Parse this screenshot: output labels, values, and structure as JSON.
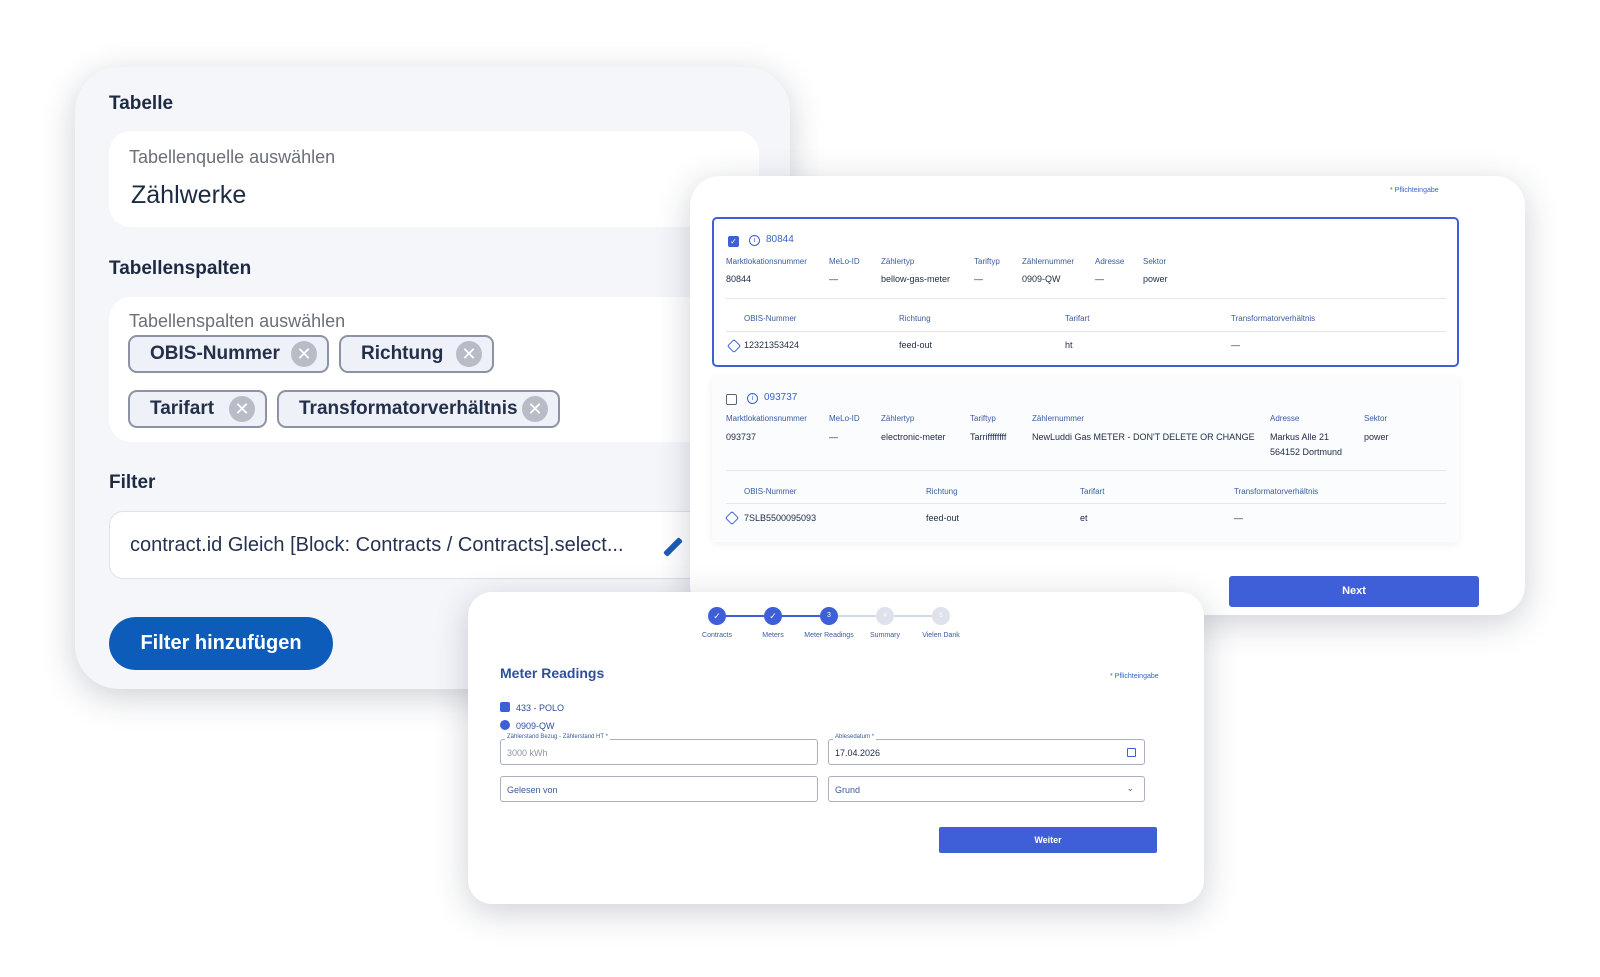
{
  "config": {
    "table_heading": "Tabelle",
    "source_label": "Tabellenquelle auswählen",
    "source_value": "Zählwerke",
    "columns_heading": "Tabellenspalten",
    "columns_label": "Tabellenspalten auswählen",
    "chips": [
      "OBIS-Nummer",
      "Richtung",
      "Tarifart",
      "Transformatorverhältnis"
    ],
    "filter_heading": "Filter",
    "filter_value": "contract.id Gleich [Block: Contracts / Contracts].select...",
    "add_filter": "Filter hinzufügen"
  },
  "meters": {
    "required_note": "* Pflichteingabe",
    "next_label": "Next",
    "items": [
      {
        "id": "80844",
        "checked": true,
        "headers": [
          "Marktlokationsnummer",
          "MeLo-ID",
          "Zählertyp",
          "Tariftyp",
          "Zählernummer",
          "Adresse",
          "Sektor"
        ],
        "values": [
          "80844",
          "—",
          "bellow-gas-meter",
          "—",
          "0909-QW",
          "—",
          "power"
        ],
        "reg_headers": [
          "OBIS-Nummer",
          "Richtung",
          "Tarifart",
          "Transformatorverhältnis"
        ],
        "reg_values": [
          "12321353424",
          "feed-out",
          "ht",
          "—"
        ]
      },
      {
        "id": "093737",
        "checked": false,
        "headers": [
          "Marktlokationsnummer",
          "MeLo-ID",
          "Zählertyp",
          "Tariftyp",
          "Zählernummer",
          "Adresse",
          "Sektor"
        ],
        "values": [
          "093737",
          "—",
          "electronic-meter",
          "Tarriffffffff",
          "NewLuddi Gas METER - DON'T DELETE OR CHANGE",
          "Markus Alle 21",
          "power"
        ],
        "address_line2": "564152 Dortmund",
        "reg_headers": [
          "OBIS-Nummer",
          "Richtung",
          "Tarifart",
          "Transformatorverhältnis"
        ],
        "reg_values": [
          "7SLB5500095093",
          "feed-out",
          "et",
          "—"
        ]
      }
    ]
  },
  "readings": {
    "steps": [
      {
        "label": "Contracts",
        "state": "done",
        "mark": "✓"
      },
      {
        "label": "Meters",
        "state": "done",
        "mark": "✓"
      },
      {
        "label": "Meter Readings",
        "state": "current",
        "mark": "3"
      },
      {
        "label": "Summary",
        "state": "todo",
        "mark": "4"
      },
      {
        "label": "Vielen Dank",
        "state": "todo",
        "mark": "5"
      }
    ],
    "title": "Meter Readings",
    "required_note": "* Pflichteingabe",
    "contract": "433 - POLO",
    "meter": "0909-QW",
    "reading_label": "Zählerstand Bezug - Zählerstand HT *",
    "reading_placeholder": "3000 kWh",
    "date_label": "Ablesedatum *",
    "date_value": "17.04.2026",
    "read_by_placeholder": "Gelesen von",
    "reason_placeholder": "Grund",
    "continue_label": "Weiter"
  }
}
